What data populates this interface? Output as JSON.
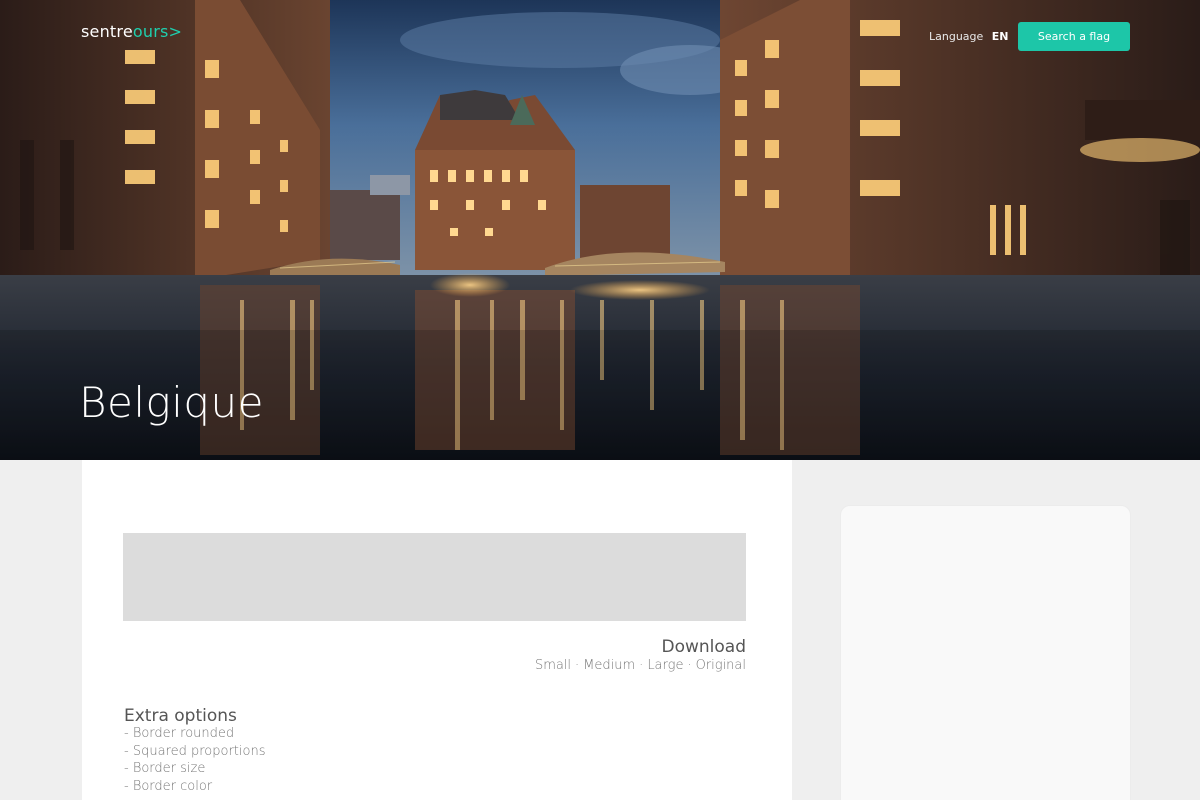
{
  "header": {
    "logo": {
      "part1": "sentre",
      "part2": "ours>"
    },
    "language_label": "Language",
    "language_code": "EN",
    "search_button": "Search a flag"
  },
  "hero": {
    "title": "Belgique",
    "image": "canal-city-night-photo"
  },
  "main": {
    "download": {
      "title": "Download",
      "sizes": [
        "Small",
        "Medium",
        "Large",
        "Original"
      ]
    },
    "extra_options": {
      "title": "Extra options",
      "items": [
        "- Border rounded",
        "- Squared proportions",
        "- Border size",
        "- Border color"
      ]
    }
  },
  "colors": {
    "accent": "#1dc6a8",
    "page_background": "#efefef",
    "card_background": "#ffffff",
    "flag_placeholder": "#dcdcdc"
  }
}
